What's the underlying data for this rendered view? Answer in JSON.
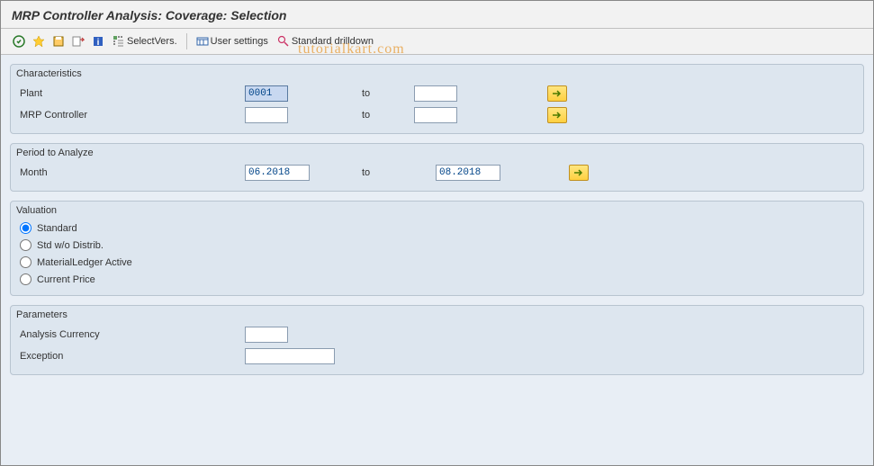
{
  "title": "MRP Controller Analysis: Coverage: Selection",
  "toolbar": {
    "select_vers": "SelectVers.",
    "user_settings": "User settings",
    "standard_drilldown": "Standard drilldown"
  },
  "watermark": "tutorialkart.com",
  "groups": {
    "characteristics": {
      "title": "Characteristics",
      "plant_label": "Plant",
      "plant_from": "0001",
      "plant_to": "",
      "mrp_label": "MRP Controller",
      "mrp_from": "",
      "mrp_to": "",
      "to_label": "to"
    },
    "period": {
      "title": "Period to Analyze",
      "month_label": "Month",
      "month_from": "06.2018",
      "month_to": "08.2018",
      "to_label": "to"
    },
    "valuation": {
      "title": "Valuation",
      "options": {
        "standard": "Standard",
        "std_wo": "Std w/o Distrib.",
        "ml_active": "MaterialLedger Active",
        "current": "Current Price"
      },
      "selected": "standard"
    },
    "parameters": {
      "title": "Parameters",
      "currency_label": "Analysis Currency",
      "currency_value": "",
      "exception_label": "Exception",
      "exception_value": ""
    }
  }
}
